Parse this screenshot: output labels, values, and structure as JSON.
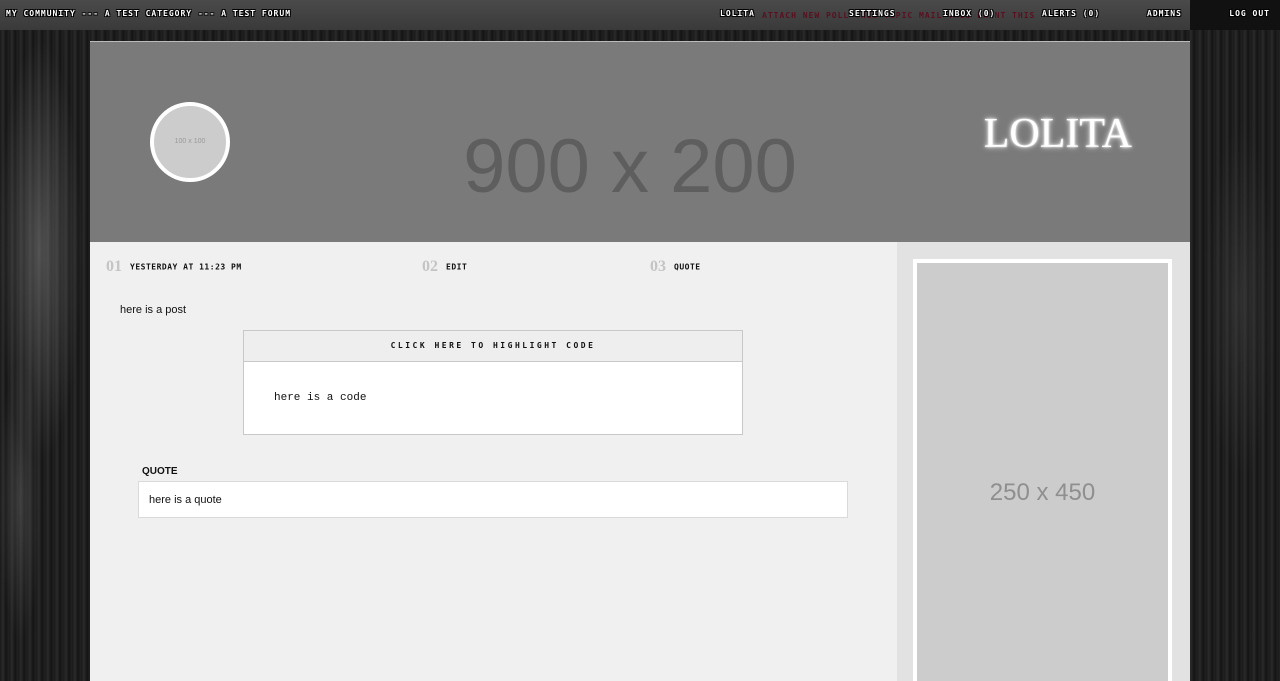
{
  "breadcrumb": "My Community --- A Test Category --- A Test Forum",
  "ghost_text": "Attach New Poll    this topic    mail this    print this",
  "nav": {
    "user": "Lolita",
    "settings": "Settings",
    "inbox": "Inbox (0)",
    "alerts": "Alerts (0)",
    "admins": "Admins",
    "logout": "Log Out"
  },
  "header": {
    "placeholder": "900 x 200",
    "avatar_placeholder": "100 x 100",
    "username": "LOLITA"
  },
  "post_meta": [
    {
      "num": "01",
      "label": "Yesterday at 11:23 PM"
    },
    {
      "num": "02",
      "label": "Edit"
    },
    {
      "num": "03",
      "label": "Quote"
    }
  ],
  "post": {
    "text": "here is a post",
    "code_header": "Click here to highlight code",
    "code": "here is a code",
    "quote_label": "Quote",
    "quote": "here is a quote"
  },
  "sidebar": {
    "placeholder": "250 x 450"
  }
}
